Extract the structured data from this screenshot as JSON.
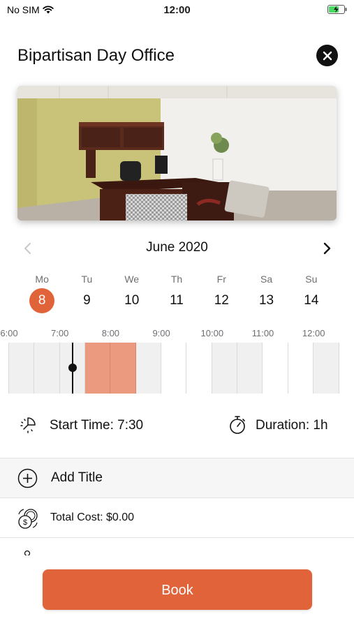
{
  "status_bar": {
    "carrier": "No SIM",
    "time": "12:00"
  },
  "header": {
    "title": "Bipartisan Day Office",
    "close_icon": "close-icon"
  },
  "hero_image": {
    "subject": "office-photo"
  },
  "calendar": {
    "month_label": "June 2020",
    "days": [
      {
        "name": "Mo",
        "date": "8",
        "selected": true
      },
      {
        "name": "Tu",
        "date": "9"
      },
      {
        "name": "We",
        "date": "10"
      },
      {
        "name": "Th",
        "date": "11"
      },
      {
        "name": "Fr",
        "date": "12"
      },
      {
        "name": "Sa",
        "date": "13"
      },
      {
        "name": "Su",
        "date": "14"
      }
    ]
  },
  "timeline": {
    "hour_labels": [
      "6:00",
      "7:00",
      "8:00",
      "9:00",
      "10:00",
      "11:00",
      "12:00"
    ],
    "current_time": "7:15",
    "selected_range": [
      "7:30",
      "8:30"
    ],
    "busy_ranges": [
      [
        "6:00",
        "7:30"
      ],
      [
        "8:30",
        "9:00"
      ],
      [
        "10:00",
        "11:00"
      ],
      [
        "12:00",
        "12:30"
      ]
    ],
    "selected_color": "#ec9a7f",
    "busy_color": "#f0f0f0"
  },
  "booking": {
    "start_time_label": "Start Time: 7:30",
    "duration_label": "Duration: 1h",
    "add_title_label": "Add Title",
    "total_cost_label": "Total Cost: $0.00",
    "book_label": "Book"
  },
  "colors": {
    "accent": "#e0633a"
  }
}
